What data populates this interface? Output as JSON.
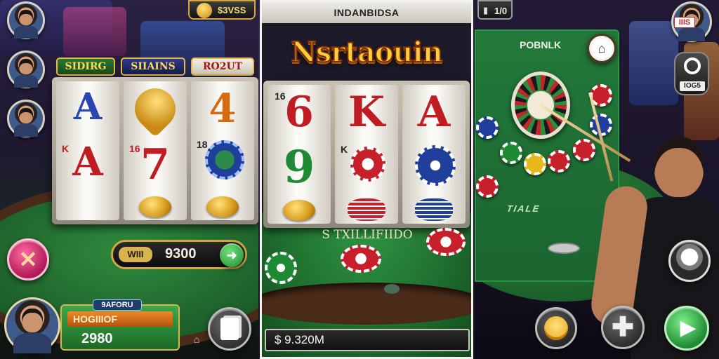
{
  "left_panel": {
    "reel_labels": [
      "SIDIRG",
      "SIIAINS",
      "RO2UT"
    ],
    "reel_symbols": [
      {
        "top": "A",
        "mid": "A",
        "mid_corner": "K"
      },
      {
        "mid": "7",
        "mid_corner": "16"
      },
      {
        "top": "4",
        "mid_corner": "18"
      }
    ],
    "win_label": "WIII",
    "win_value": "9300",
    "player_tag": "9AFORU",
    "player_name": "HOGIIIOF",
    "player_value": "2980"
  },
  "middle_panel": {
    "top_title": "INDANBIDSA",
    "logo": "Nsrtaouin",
    "top_bar_amount": "$3VSS",
    "reel_corners": [
      "16",
      "",
      ""
    ],
    "reel_symbols": [
      {
        "top": "6",
        "mid": "9"
      },
      {
        "top": "K",
        "mid_corner": "K"
      },
      {
        "top": "A"
      }
    ],
    "table_text": "S TXILLIFIIDO",
    "bottom_amount": "$ 9.320M"
  },
  "right_panel": {
    "top_counter": "1/0",
    "board_title": "POBNLK",
    "table_sign": "TIALE",
    "side_button_label": "IOG5",
    "avatar_badge": "IIIS"
  },
  "colors": {
    "accent_gold": "#ffcf3a",
    "felt_green": "#2f8a3e",
    "chip_red": "#c7202a",
    "chip_blue": "#1f3f9a",
    "play_green": "#2fb24a"
  },
  "icons": [
    "x-icon",
    "card-icon",
    "home-icon",
    "play-icon",
    "plus-icon",
    "target-icon",
    "emoji-icon",
    "tag-icon"
  ]
}
